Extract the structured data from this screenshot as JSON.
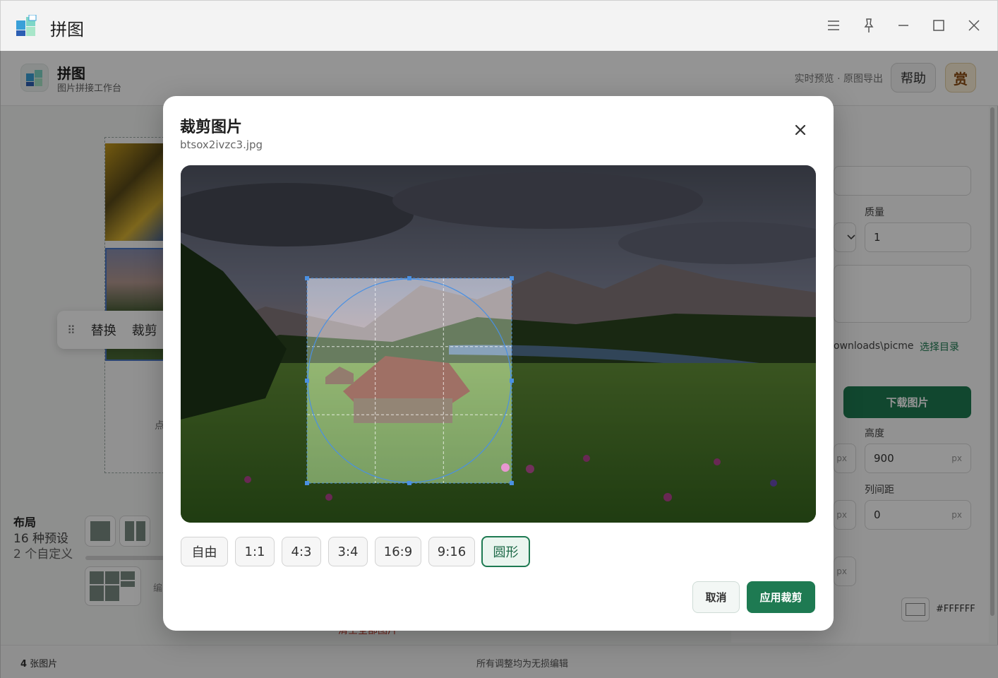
{
  "window": {
    "title": "拼图"
  },
  "header": {
    "brand_name": "拼图",
    "brand_sub": "图片拼接工作台",
    "note": "实时预览 · 原图导出",
    "help_label": "帮助",
    "reward_label": "赏"
  },
  "float_toolbar": {
    "replace_label": "替换",
    "crop_label": "裁剪"
  },
  "canvas": {
    "hint_fragment": "点"
  },
  "layout": {
    "title": "布局",
    "presets": "16 种预设",
    "custom": "2 个自定义",
    "edit_fragment": "编",
    "clear_label": "清空全部图片"
  },
  "export": {
    "quality_label": "质量",
    "quality_value": "1",
    "dir_path": "ownloads\\picme",
    "dir_button": "选择目录",
    "download_label": "下载图片"
  },
  "size": {
    "height_label": "高度",
    "height_value": "900",
    "col_gap_label": "列间距",
    "col_gap_value": "0",
    "unit": "px",
    "bg_color": "#FFFFFF"
  },
  "status": {
    "count": "4",
    "count_suffix": "张图片",
    "center": "所有调整均为无损编辑"
  },
  "modal": {
    "title": "裁剪图片",
    "file_name": "btsox2ivzc3.jpg",
    "ratios": [
      "自由",
      "1:1",
      "4:3",
      "3:4",
      "16:9",
      "9:16",
      "圆形"
    ],
    "selected_ratio": "圆形",
    "cancel_label": "取消",
    "apply_label": "应用裁剪"
  },
  "colors": {
    "accent": "#1e7a52",
    "crop_handle": "#4a90e2"
  }
}
